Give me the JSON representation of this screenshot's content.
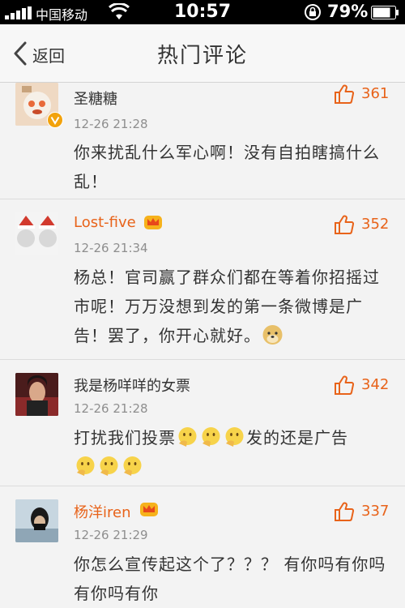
{
  "status_bar": {
    "carrier": "中国移动",
    "time": "10:57",
    "battery": "79%"
  },
  "nav": {
    "back_label": "返回",
    "title": "热门评论"
  },
  "comments": [
    {
      "username": "圣糖糖",
      "time": "12-26 21:28",
      "likes": "361",
      "text": "你来扰乱什么军心啊！没有自拍瞎搞什么乱！",
      "verified": true,
      "vip": false
    },
    {
      "username": "Lost-five",
      "time": "12-26 21:34",
      "likes": "352",
      "text": "杨总！官司赢了群众们都在等着你招摇过市呢！万万没想到发的第一条微博是广告！罢了，你开心就好。",
      "vip": true
    },
    {
      "username": "我是杨咩咩的女票",
      "time": "12-26 21:28",
      "likes": "342",
      "text": "打扰我们投票",
      "text_after": "发的还是广告",
      "vip": false
    },
    {
      "username": "杨洋iren",
      "time": "12-26 21:29",
      "likes": "337",
      "text": "你怎么宣传起这个了？？？ 有你吗有你吗有你吗有你",
      "vip": true
    }
  ],
  "colors": {
    "accent": "#e8631a",
    "background": "#f3f3f3",
    "nav_bg": "#f7f7f7"
  },
  "icons": [
    "signal-icon",
    "wifi-icon",
    "rotation-lock-icon",
    "battery-icon",
    "back-chevron-icon",
    "thumbs-up-icon",
    "crown-icon",
    "verified-badge-icon",
    "emoji-icon"
  ]
}
